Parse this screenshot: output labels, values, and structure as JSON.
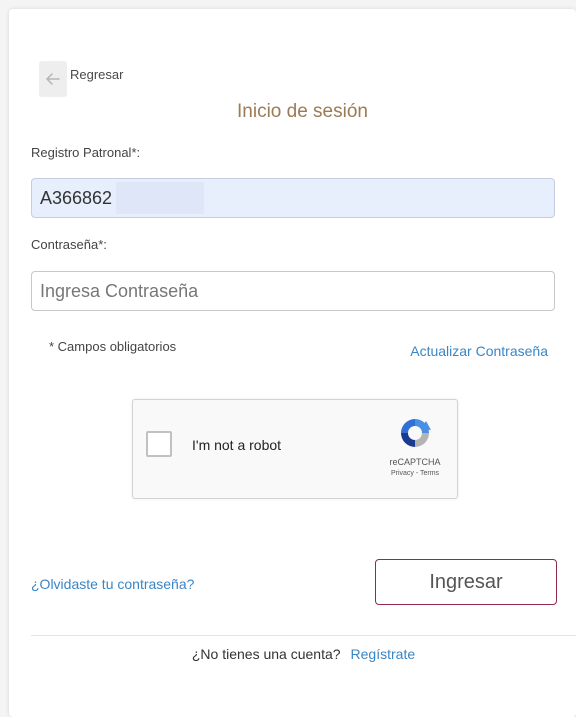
{
  "back": {
    "label": "Regresar"
  },
  "title": "Inicio de sesión",
  "registro": {
    "label": "Registro Patronal*:",
    "value": "A366862"
  },
  "password": {
    "label": "Contraseña*:",
    "placeholder": "Ingresa Contraseña"
  },
  "required_note": "* Campos obligatorios",
  "update_password_link": "Actualizar Contraseña",
  "captcha": {
    "label": "I'm not a robot",
    "brand": "reCAPTCHA",
    "terms": "Privacy - Terms"
  },
  "forgot_link": "¿Olvidaste tu contraseña?",
  "login_button": "Ingresar",
  "footer": {
    "question": "¿No tienes una cuenta?",
    "register_link": "Regístrate"
  },
  "colors": {
    "title": "#9b7b54",
    "link": "#3a86c5",
    "button_border": "#8e2d4b",
    "filled_input_bg": "#e7eefc"
  },
  "icons": {
    "back": "arrow-left-icon",
    "captcha": "recaptcha-logo-icon"
  }
}
